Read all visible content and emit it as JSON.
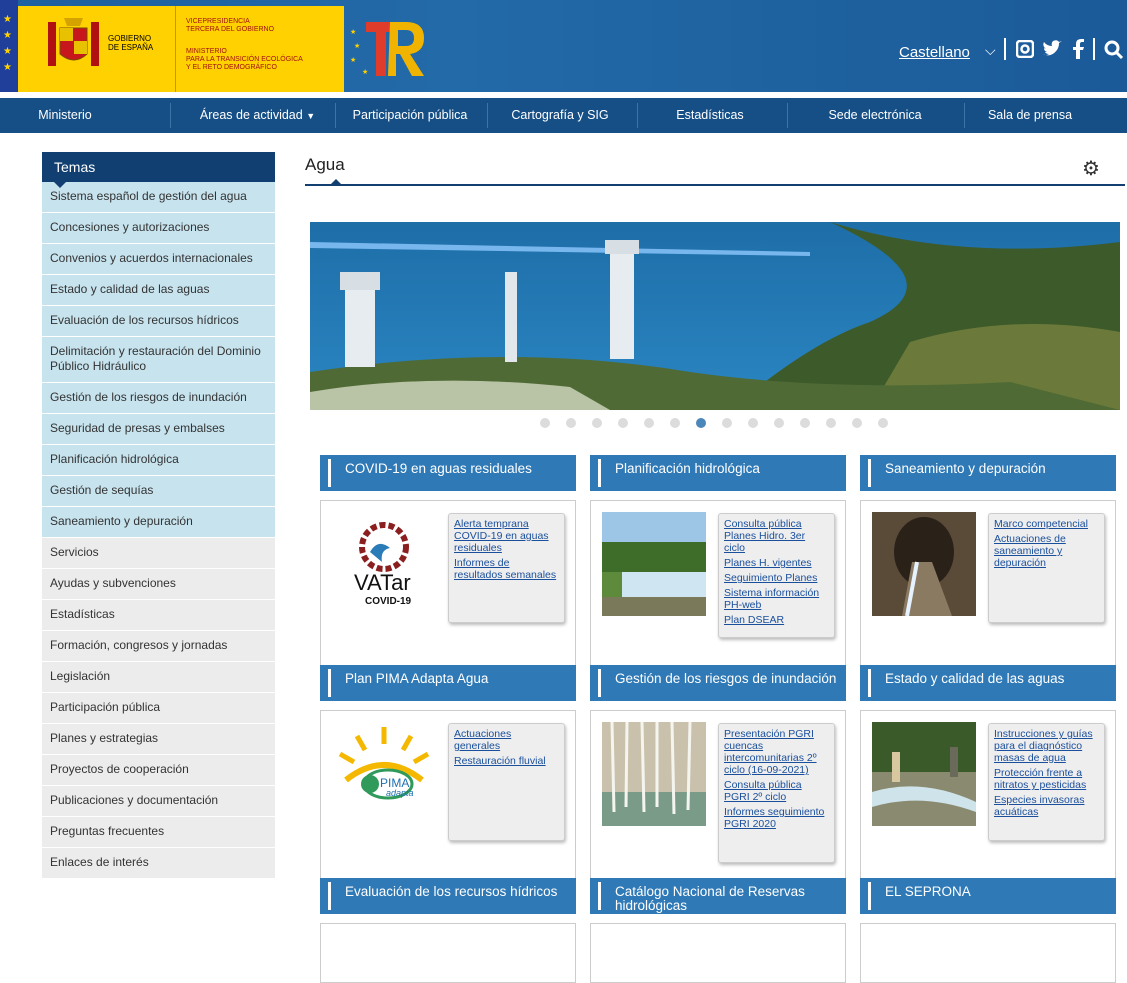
{
  "header": {
    "gobierno": "GOBIERNO\nDE ESPAÑA",
    "vice_title": "VICEPRESIDENCIA\nTERCERA DEL GOBIERNO",
    "ministry": "MINISTERIO\nPARA LA TRANSICIÓN ECOLÓGICA\nY EL RETO DEMOGRÁFICO",
    "language": "Castellano",
    "icons": [
      "instagram-icon",
      "twitter-icon",
      "facebook-icon",
      "search-icon"
    ],
    "colors": {
      "bar": "#1d5fa0",
      "nav": "#164f86",
      "gold": "#ffd100"
    }
  },
  "nav": [
    "Ministerio",
    "Áreas de actividad",
    "Participación pública",
    "Cartografía y SIG",
    "Estadísticas",
    "Sede electrónica",
    "Sala de prensa"
  ],
  "sidebar": {
    "title": "Temas",
    "topics": [
      "Sistema español de gestión del agua",
      "Concesiones y autorizaciones",
      "Convenios y acuerdos internacionales",
      "Estado y calidad de las aguas",
      "Evaluación de los recursos hídricos",
      "Delimitación y restauración del Dominio Público Hidráulico",
      "Gestión de los riesgos de inundación",
      "Seguridad de presas y embalses",
      "Planificación hidrológica",
      "Gestión de sequías",
      "Saneamiento y depuración"
    ],
    "general": [
      "Servicios",
      "Ayudas y subvenciones",
      "Estadísticas",
      "Formación, congresos y jornadas",
      "Legislación",
      "Participación pública",
      "Planes y estrategias",
      "Proyectos de cooperación",
      "Publicaciones y documentación",
      "Preguntas frecuentes",
      "Enlaces de interés"
    ]
  },
  "main": {
    "title": "Agua",
    "carousel": {
      "count": 14,
      "active": 6
    },
    "cards": [
      {
        "title": "COVID-19 en aguas residuales",
        "logo": "VATar",
        "logo_sub": "COVID-19",
        "links": [
          "Alerta temprana COVID-19 en aguas residuales",
          "Informes de resultados semanales"
        ]
      },
      {
        "title": "Planificación hidrológica",
        "links": [
          "Consulta pública Planes Hidro. 3er ciclo",
          "Planes H. vigentes",
          "Seguimiento Planes",
          "Sistema información PH-web",
          "Plan DSEAR"
        ]
      },
      {
        "title": "Saneamiento y depuración",
        "links": [
          "Marco competencial",
          "Actuaciones de saneamiento y depuración"
        ]
      },
      {
        "title": "Plan PIMA Adapta Agua",
        "logo": "PIMA",
        "logo_sub": "adapta",
        "links": [
          "Actuaciones generales",
          "Restauración fluvial"
        ]
      },
      {
        "title": "Gestión de los riesgos de inundación",
        "links": [
          "Presentación PGRI cuencas intercomunitarias 2º ciclo (16-09-2021)",
          "Consulta pública PGRI 2º ciclo",
          "Informes seguimiento PGRI 2020"
        ]
      },
      {
        "title": "Estado y calidad de las aguas",
        "links": [
          "Instrucciones y guías para el diagnóstico masas de agua",
          "Protección frente a nitratos y pesticidas",
          "Especies invasoras acuáticas"
        ]
      },
      {
        "title": "Evaluación de los recursos hídricos",
        "links": []
      },
      {
        "title": "Catálogo Nacional de Reservas hidrológicas",
        "links": []
      },
      {
        "title": "EL SEPRONA",
        "links": []
      }
    ]
  }
}
